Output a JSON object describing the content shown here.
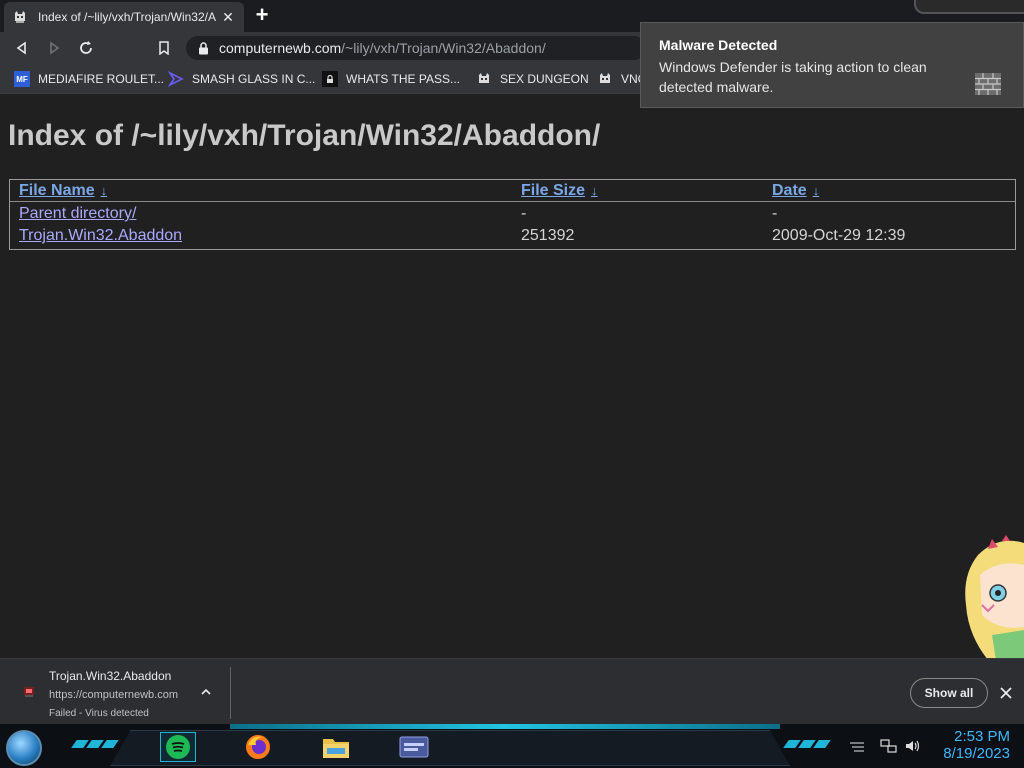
{
  "browser": {
    "tab": {
      "title": "Index of /~lily/vxh/Trojan/Win32/A",
      "favicon": "tabby-cat-icon"
    },
    "new_tab_label": "+",
    "url_host": "computernewb.com",
    "url_path": "/~lily/vxh/Trojan/Win32/Abaddon/",
    "bookmarks": [
      {
        "label": "MEDIAFIRE ROULET...",
        "icon": "mediafire-icon",
        "icon_text": "MF"
      },
      {
        "label": "SMASH GLASS IN C...",
        "icon": "chevron-icon"
      },
      {
        "label": "WHATS THE PASS...",
        "icon": "lock-icon"
      },
      {
        "label": "SEX DUNGEON",
        "icon": "tabby-cat-icon"
      },
      {
        "label": "VNC",
        "icon": "tabby-cat-icon"
      }
    ]
  },
  "page": {
    "heading": "Index of /~lily/vxh/Trojan/Win32/Abaddon/",
    "columns": [
      {
        "label": "File Name",
        "sort": "↓"
      },
      {
        "label": "File Size",
        "sort": "↓"
      },
      {
        "label": "Date",
        "sort": "↓"
      }
    ],
    "rows": [
      {
        "name": "Parent directory/",
        "size": "-",
        "date": "-"
      },
      {
        "name": "Trojan.Win32.Abaddon",
        "size": "251392",
        "date": "2009-Oct-29 12:39"
      }
    ]
  },
  "notification": {
    "title": "Malware Detected",
    "body": "Windows Defender is taking action to clean detected malware."
  },
  "download": {
    "filename": "Trojan.Win32.Abaddon",
    "source": "https://computernewb.com",
    "status": "Failed - Virus detected",
    "show_all": "Show all"
  },
  "taskbar": {
    "time": "2:53 PM",
    "date": "8/19/2023",
    "accent": "#1fb5d6",
    "clock_color": "#3fb8ff"
  }
}
